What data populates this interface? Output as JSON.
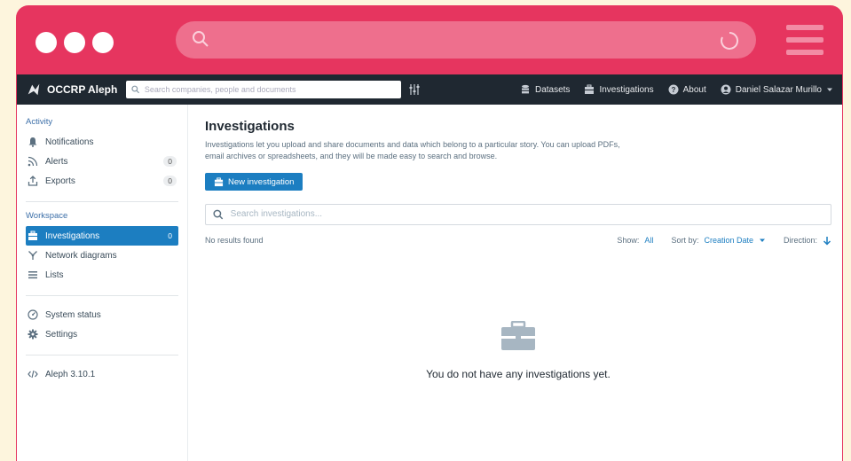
{
  "app": {
    "brand": "OCCRP Aleph",
    "search_placeholder": "Search companies, people and documents"
  },
  "nav": {
    "datasets": "Datasets",
    "investigations": "Investigations",
    "about": "About",
    "user": "Daniel Salazar Murillo"
  },
  "sidebar": {
    "activity_title": "Activity",
    "activity": [
      {
        "label": "Notifications",
        "icon": "bell-icon"
      },
      {
        "label": "Alerts",
        "count": "0",
        "icon": "feed-icon"
      },
      {
        "label": "Exports",
        "count": "0",
        "icon": "export-icon"
      }
    ],
    "workspace_title": "Workspace",
    "workspace": [
      {
        "label": "Investigations",
        "count": "0",
        "icon": "briefcase-icon"
      },
      {
        "label": "Network diagrams",
        "icon": "graph-icon"
      },
      {
        "label": "Lists",
        "icon": "list-icon"
      }
    ],
    "system": [
      {
        "label": "System status",
        "icon": "dashboard-icon"
      },
      {
        "label": "Settings",
        "icon": "gear-icon"
      }
    ],
    "version": "Aleph 3.10.1"
  },
  "main": {
    "title": "Investigations",
    "description": "Investigations let you upload and share documents and data which belong to a particular story. You can upload PDFs, email archives or spreadsheets, and they will be made easy to search and browse.",
    "new_button": "New investigation",
    "search_placeholder": "Search investigations...",
    "no_results": "No results found",
    "show_label": "Show:",
    "show_value": "All",
    "sort_label": "Sort by:",
    "sort_value": "Creation Date",
    "direction_label": "Direction:",
    "empty_message": "You do not have any investigations yet."
  },
  "colors": {
    "frame": "#e6355f",
    "navbar": "#1f2831",
    "accent": "#1c7ec1"
  }
}
